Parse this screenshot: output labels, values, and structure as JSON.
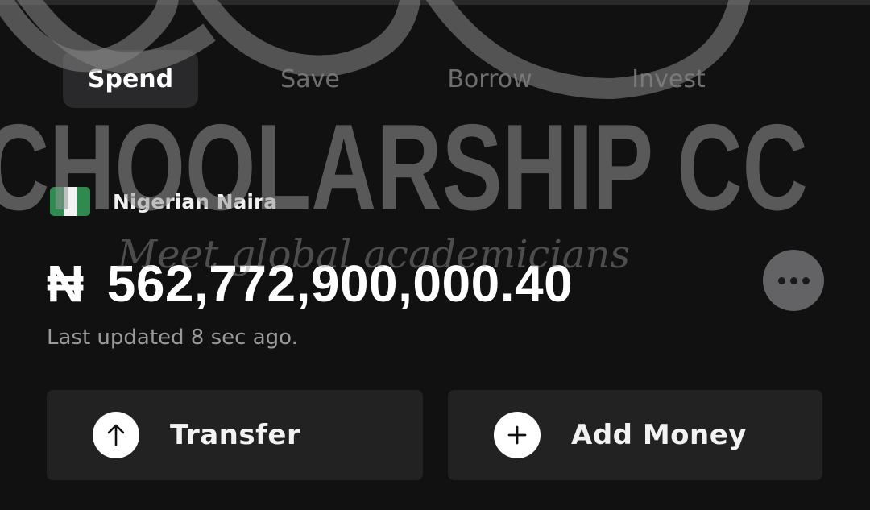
{
  "tabs": [
    {
      "label": "Spend",
      "active": true
    },
    {
      "label": "Save",
      "active": false
    },
    {
      "label": "Borrow",
      "active": false
    },
    {
      "label": "Invest",
      "active": false
    }
  ],
  "account": {
    "currency_name": "Nigerian Naira",
    "flag_icon": "nigeria-flag-icon",
    "currency_symbol": "₦",
    "balance": "562,772,900,000.40",
    "last_updated": "Last updated 8 sec ago."
  },
  "more_button": {
    "icon": "more-horizontal-icon"
  },
  "actions": {
    "transfer": {
      "label": "Transfer",
      "icon": "arrow-up-icon"
    },
    "add_money": {
      "label": "Add Money",
      "icon": "plus-icon"
    }
  },
  "watermark": {
    "title": "CHOOLARSHIP CC",
    "tagline": "Meet global academicians"
  },
  "colors": {
    "background": "#111112",
    "tab_active_bg": "#29292b",
    "button_bg": "#222223",
    "flag_green": "#2e8a4e",
    "muted_text": "#9a9a9c"
  }
}
